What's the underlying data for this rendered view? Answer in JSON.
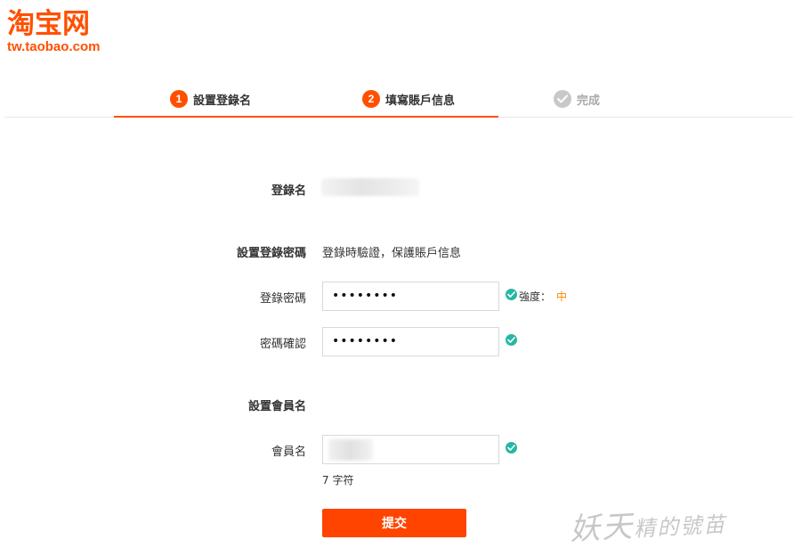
{
  "logo": {
    "name": "淘宝网",
    "url": "tw.taobao.com"
  },
  "steps": [
    {
      "num": "1",
      "label": "設置登錄名",
      "state": "done"
    },
    {
      "num": "2",
      "label": "填寫賬戶信息",
      "state": "active"
    },
    {
      "num": "",
      "label": "完成",
      "state": "pending"
    }
  ],
  "form": {
    "login_name_label": "登錄名",
    "password_section_label": "設置登錄密碼",
    "password_hint": "登錄時驗證，保護賬戶信息",
    "password_label": "登錄密碼",
    "password_value": "••••••••",
    "strength_label": "強度：",
    "strength_level": "中",
    "confirm_label": "密碼確認",
    "confirm_value": "••••••••",
    "member_section_label": "設置會員名",
    "member_label": "會員名",
    "member_counter": "7 字符",
    "submit_label": "提交"
  },
  "watermark": {
    "big": "妖天",
    "small": "精的號苗"
  },
  "colors": {
    "brand": "#ff5000",
    "submit": "#ff4400",
    "ok": "#27b7a4",
    "strength": "#ff8800"
  }
}
